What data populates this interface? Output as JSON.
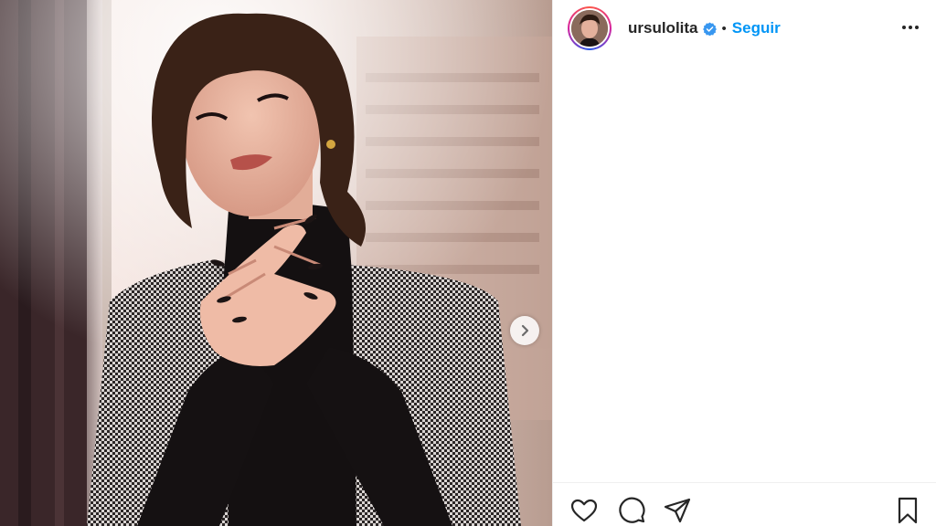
{
  "post": {
    "username": "ursulolita",
    "separator": "•",
    "follow_label": "Seguir",
    "verified": true,
    "accent_color": "#0095f6"
  },
  "icons": {
    "verified": "verified-badge-icon",
    "more": "more-options-icon",
    "next": "chevron-right-icon",
    "like": "heart-icon",
    "comment": "comment-icon",
    "share": "paper-plane-icon",
    "save": "bookmark-icon"
  }
}
